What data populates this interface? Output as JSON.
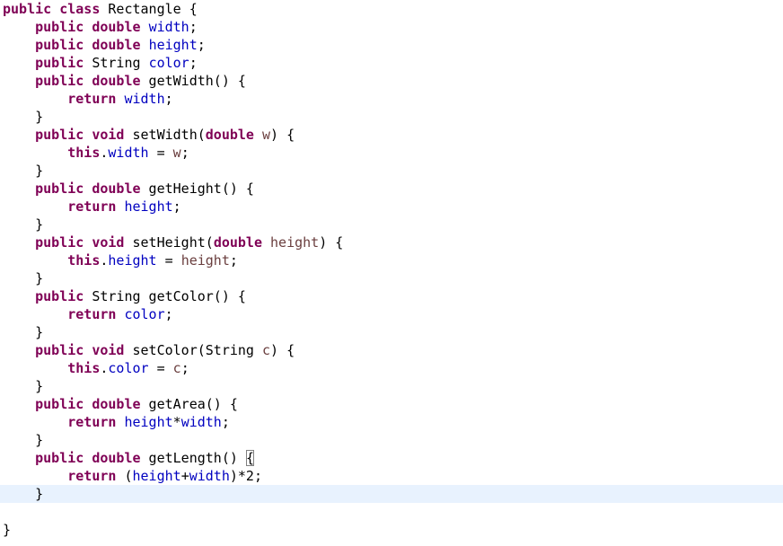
{
  "editor": {
    "current_line_index": 27,
    "matching_bracket_line_index": 25,
    "colors": {
      "keyword": "#7f0055",
      "field": "#0000c0",
      "parameter": "#6a3e3e",
      "plain": "#000000",
      "current_line_highlight": "#e8f2fe",
      "bracket_box": "#808080"
    },
    "lines": [
      [
        {
          "t": "kw",
          "v": "public"
        },
        {
          "t": "plain",
          "v": " "
        },
        {
          "t": "kw",
          "v": "class"
        },
        {
          "t": "plain",
          "v": " Rectangle {"
        }
      ],
      [
        {
          "t": "plain",
          "v": "    "
        },
        {
          "t": "kw",
          "v": "public"
        },
        {
          "t": "plain",
          "v": " "
        },
        {
          "t": "kw",
          "v": "double"
        },
        {
          "t": "plain",
          "v": " "
        },
        {
          "t": "field",
          "v": "width"
        },
        {
          "t": "plain",
          "v": ";"
        }
      ],
      [
        {
          "t": "plain",
          "v": "    "
        },
        {
          "t": "kw",
          "v": "public"
        },
        {
          "t": "plain",
          "v": " "
        },
        {
          "t": "kw",
          "v": "double"
        },
        {
          "t": "plain",
          "v": " "
        },
        {
          "t": "field",
          "v": "height"
        },
        {
          "t": "plain",
          "v": ";"
        }
      ],
      [
        {
          "t": "plain",
          "v": "    "
        },
        {
          "t": "kw",
          "v": "public"
        },
        {
          "t": "plain",
          "v": " String "
        },
        {
          "t": "field",
          "v": "color"
        },
        {
          "t": "plain",
          "v": ";"
        }
      ],
      [
        {
          "t": "plain",
          "v": "    "
        },
        {
          "t": "kw",
          "v": "public"
        },
        {
          "t": "plain",
          "v": " "
        },
        {
          "t": "kw",
          "v": "double"
        },
        {
          "t": "plain",
          "v": " getWidth() {"
        }
      ],
      [
        {
          "t": "plain",
          "v": "        "
        },
        {
          "t": "kw",
          "v": "return"
        },
        {
          "t": "plain",
          "v": " "
        },
        {
          "t": "field",
          "v": "width"
        },
        {
          "t": "plain",
          "v": ";"
        }
      ],
      [
        {
          "t": "plain",
          "v": "    }"
        }
      ],
      [
        {
          "t": "plain",
          "v": "    "
        },
        {
          "t": "kw",
          "v": "public"
        },
        {
          "t": "plain",
          "v": " "
        },
        {
          "t": "kw",
          "v": "void"
        },
        {
          "t": "plain",
          "v": " setWidth("
        },
        {
          "t": "kw",
          "v": "double"
        },
        {
          "t": "plain",
          "v": " "
        },
        {
          "t": "param",
          "v": "w"
        },
        {
          "t": "plain",
          "v": ") {"
        }
      ],
      [
        {
          "t": "plain",
          "v": "        "
        },
        {
          "t": "kw",
          "v": "this"
        },
        {
          "t": "plain",
          "v": "."
        },
        {
          "t": "field",
          "v": "width"
        },
        {
          "t": "plain",
          "v": " = "
        },
        {
          "t": "param",
          "v": "w"
        },
        {
          "t": "plain",
          "v": ";"
        }
      ],
      [
        {
          "t": "plain",
          "v": "    }"
        }
      ],
      [
        {
          "t": "plain",
          "v": "    "
        },
        {
          "t": "kw",
          "v": "public"
        },
        {
          "t": "plain",
          "v": " "
        },
        {
          "t": "kw",
          "v": "double"
        },
        {
          "t": "plain",
          "v": " getHeight() {"
        }
      ],
      [
        {
          "t": "plain",
          "v": "        "
        },
        {
          "t": "kw",
          "v": "return"
        },
        {
          "t": "plain",
          "v": " "
        },
        {
          "t": "field",
          "v": "height"
        },
        {
          "t": "plain",
          "v": ";"
        }
      ],
      [
        {
          "t": "plain",
          "v": "    }"
        }
      ],
      [
        {
          "t": "plain",
          "v": "    "
        },
        {
          "t": "kw",
          "v": "public"
        },
        {
          "t": "plain",
          "v": " "
        },
        {
          "t": "kw",
          "v": "void"
        },
        {
          "t": "plain",
          "v": " setHeight("
        },
        {
          "t": "kw",
          "v": "double"
        },
        {
          "t": "plain",
          "v": " "
        },
        {
          "t": "param",
          "v": "height"
        },
        {
          "t": "plain",
          "v": ") {"
        }
      ],
      [
        {
          "t": "plain",
          "v": "        "
        },
        {
          "t": "kw",
          "v": "this"
        },
        {
          "t": "plain",
          "v": "."
        },
        {
          "t": "field",
          "v": "height"
        },
        {
          "t": "plain",
          "v": " = "
        },
        {
          "t": "param",
          "v": "height"
        },
        {
          "t": "plain",
          "v": ";"
        }
      ],
      [
        {
          "t": "plain",
          "v": "    }"
        }
      ],
      [
        {
          "t": "plain",
          "v": "    "
        },
        {
          "t": "kw",
          "v": "public"
        },
        {
          "t": "plain",
          "v": " String getColor() {"
        }
      ],
      [
        {
          "t": "plain",
          "v": "        "
        },
        {
          "t": "kw",
          "v": "return"
        },
        {
          "t": "plain",
          "v": " "
        },
        {
          "t": "field",
          "v": "color"
        },
        {
          "t": "plain",
          "v": ";"
        }
      ],
      [
        {
          "t": "plain",
          "v": "    }"
        }
      ],
      [
        {
          "t": "plain",
          "v": "    "
        },
        {
          "t": "kw",
          "v": "public"
        },
        {
          "t": "plain",
          "v": " "
        },
        {
          "t": "kw",
          "v": "void"
        },
        {
          "t": "plain",
          "v": " setColor(String "
        },
        {
          "t": "param",
          "v": "c"
        },
        {
          "t": "plain",
          "v": ") {"
        }
      ],
      [
        {
          "t": "plain",
          "v": "        "
        },
        {
          "t": "kw",
          "v": "this"
        },
        {
          "t": "plain",
          "v": "."
        },
        {
          "t": "field",
          "v": "color"
        },
        {
          "t": "plain",
          "v": " = "
        },
        {
          "t": "param",
          "v": "c"
        },
        {
          "t": "plain",
          "v": ";"
        }
      ],
      [
        {
          "t": "plain",
          "v": "    }"
        }
      ],
      [
        {
          "t": "plain",
          "v": "    "
        },
        {
          "t": "kw",
          "v": "public"
        },
        {
          "t": "plain",
          "v": " "
        },
        {
          "t": "kw",
          "v": "double"
        },
        {
          "t": "plain",
          "v": " getArea() {"
        }
      ],
      [
        {
          "t": "plain",
          "v": "        "
        },
        {
          "t": "kw",
          "v": "return"
        },
        {
          "t": "plain",
          "v": " "
        },
        {
          "t": "field",
          "v": "height"
        },
        {
          "t": "plain",
          "v": "*"
        },
        {
          "t": "field",
          "v": "width"
        },
        {
          "t": "plain",
          "v": ";"
        }
      ],
      [
        {
          "t": "plain",
          "v": "    }"
        }
      ],
      [
        {
          "t": "plain",
          "v": "    "
        },
        {
          "t": "kw",
          "v": "public"
        },
        {
          "t": "plain",
          "v": " "
        },
        {
          "t": "kw",
          "v": "double"
        },
        {
          "t": "plain",
          "v": " getLength() "
        },
        {
          "t": "bracket",
          "v": "{"
        }
      ],
      [
        {
          "t": "plain",
          "v": "        "
        },
        {
          "t": "kw",
          "v": "return"
        },
        {
          "t": "plain",
          "v": " ("
        },
        {
          "t": "field",
          "v": "height"
        },
        {
          "t": "plain",
          "v": "+"
        },
        {
          "t": "field",
          "v": "width"
        },
        {
          "t": "plain",
          "v": ")*2;"
        }
      ],
      [
        {
          "t": "plain",
          "v": "    }"
        }
      ],
      [
        {
          "t": "plain",
          "v": ""
        }
      ],
      [
        {
          "t": "plain",
          "v": "}"
        }
      ]
    ]
  }
}
